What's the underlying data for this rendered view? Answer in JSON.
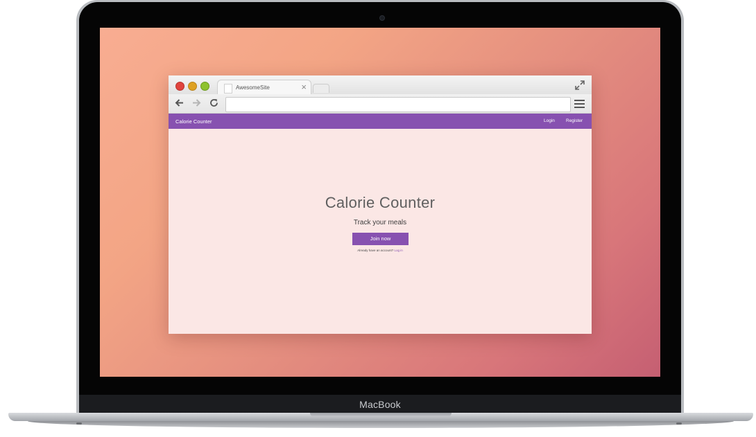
{
  "device": {
    "brand_label": "MacBook"
  },
  "browser": {
    "tab_title": "AwesomeSite",
    "tab_close": "×",
    "url": ""
  },
  "site": {
    "nav": {
      "brand": "Calorie Counter",
      "login": "Login",
      "register": "Register"
    },
    "hero": {
      "title": "Calorie Counter",
      "subtitle": "Track your meals",
      "join_button": "Join now",
      "account_prompt": "Already have an account?",
      "login_link": "Log in"
    }
  },
  "colors": {
    "accent": "#8751b0",
    "page_background": "#fbe7e5",
    "wallpaper_start": "#f8ad92",
    "wallpaper_end": "#c55f72"
  }
}
